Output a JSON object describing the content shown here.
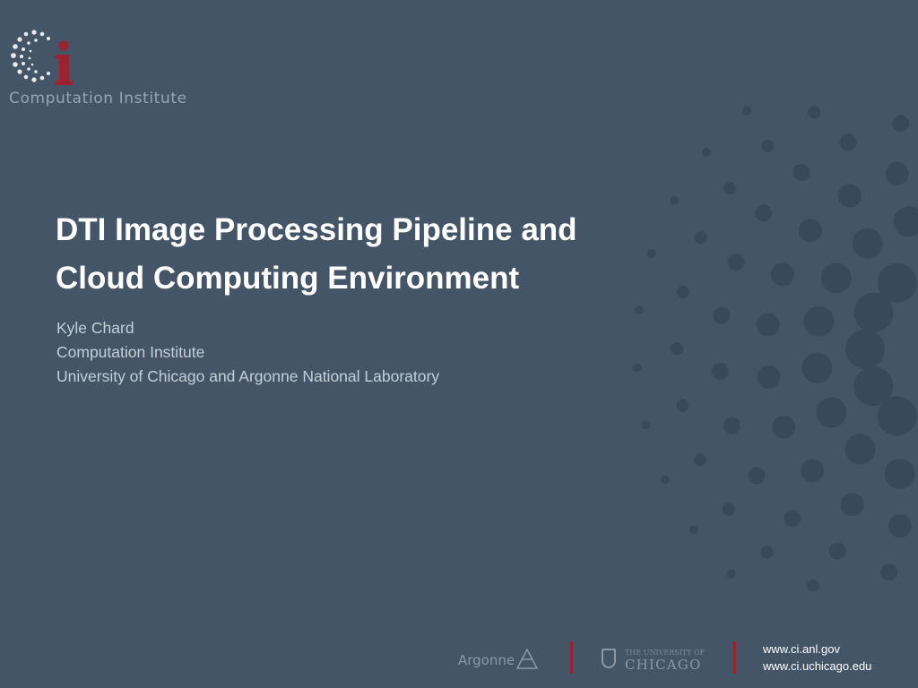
{
  "slide": {
    "logo": {
      "text": "Computation Institute",
      "icon": "ci-logo-icon",
      "accent_color": "#9b2230"
    },
    "title_lines": [
      "DTI Image Processing Pipeline and",
      "Cloud Computing Environment"
    ],
    "subtitle_lines": [
      "Kyle Chard",
      "Computation Institute",
      "University of Chicago and Argonne National Laboratory"
    ],
    "footer": {
      "argonne": "Argonne",
      "uchicago_small": "THE UNIVERSITY OF",
      "uchicago": "CHICAGO",
      "urls": [
        "www.ci.anl.gov",
        "www.ci.uchicago.edu"
      ]
    },
    "colors": {
      "background": "#435567",
      "dots": "#38495a",
      "accent": "#9b2230",
      "title": "#ffffff"
    }
  }
}
